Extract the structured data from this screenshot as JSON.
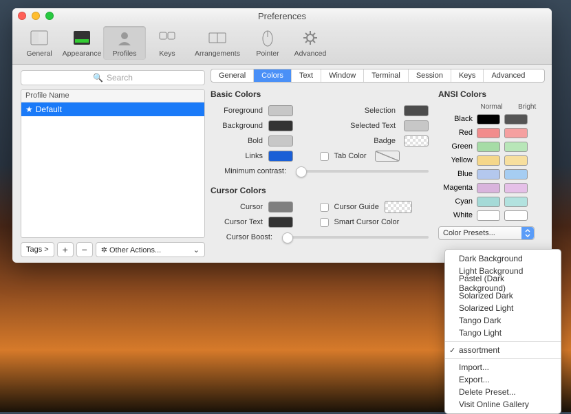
{
  "window": {
    "title": "Preferences"
  },
  "toolbar": {
    "items": [
      {
        "label": "General"
      },
      {
        "label": "Appearance"
      },
      {
        "label": "Profiles"
      },
      {
        "label": "Keys"
      },
      {
        "label": "Arrangements"
      },
      {
        "label": "Pointer"
      },
      {
        "label": "Advanced"
      }
    ]
  },
  "search": {
    "placeholder": "Search"
  },
  "profiles": {
    "header": "Profile Name",
    "items": [
      "Default"
    ]
  },
  "leftbar": {
    "tags": "Tags >",
    "other_actions": "Other Actions..."
  },
  "tabs": [
    "General",
    "Colors",
    "Text",
    "Window",
    "Terminal",
    "Session",
    "Keys",
    "Advanced"
  ],
  "sections": {
    "basic": "Basic Colors",
    "basic_items": {
      "foreground": "Foreground",
      "background": "Background",
      "bold": "Bold",
      "links": "Links",
      "selection": "Selection",
      "selected_text": "Selected Text",
      "badge": "Badge",
      "tab_color": "Tab Color",
      "min_contrast": "Minimum contrast:"
    },
    "basic_swatches": {
      "foreground": "#c7c7c7",
      "background": "#333333",
      "bold": "#c7c7c7",
      "links": "#1a5fd6",
      "selection": "#4c4c4c",
      "selected_text": "#c7c7c7",
      "badge": "#f08c8c"
    },
    "cursor": "Cursor Colors",
    "cursor_items": {
      "cursor": "Cursor",
      "cursor_text": "Cursor Text",
      "cursor_guide": "Cursor Guide",
      "smart": "Smart Cursor Color",
      "cursor_boost": "Cursor Boost:"
    },
    "cursor_swatches": {
      "cursor": "#7f7f7f",
      "cursor_text": "#333333"
    },
    "ansi": "ANSI Colors",
    "ansi_hdr": {
      "normal": "Normal",
      "bright": "Bright"
    },
    "ansi_rows": [
      {
        "label": "Black",
        "n": "#000000",
        "b": "#555555"
      },
      {
        "label": "Red",
        "n": "#f28c8c",
        "b": "#f5a0a0"
      },
      {
        "label": "Green",
        "n": "#a6dca6",
        "b": "#b8e6b8"
      },
      {
        "label": "Yellow",
        "n": "#f5d78a",
        "b": "#f7df9e"
      },
      {
        "label": "Blue",
        "n": "#b4c8ee",
        "b": "#a6cdf2"
      },
      {
        "label": "Magenta",
        "n": "#d9b4dd",
        "b": "#e5c0e8"
      },
      {
        "label": "Cyan",
        "n": "#a5dad7",
        "b": "#b2e2df"
      },
      {
        "label": "White",
        "n": "#ffffff",
        "b": "#ffffff"
      }
    ],
    "presets_label": "Color Presets..."
  },
  "menu": {
    "group1": [
      "Dark Background",
      "Light Background",
      "Pastel (Dark Background)",
      "Solarized Dark",
      "Solarized Light",
      "Tango Dark",
      "Tango Light"
    ],
    "checked": "assortment",
    "group2": [
      "Import...",
      "Export...",
      "Delete Preset...",
      "Visit Online Gallery"
    ]
  }
}
